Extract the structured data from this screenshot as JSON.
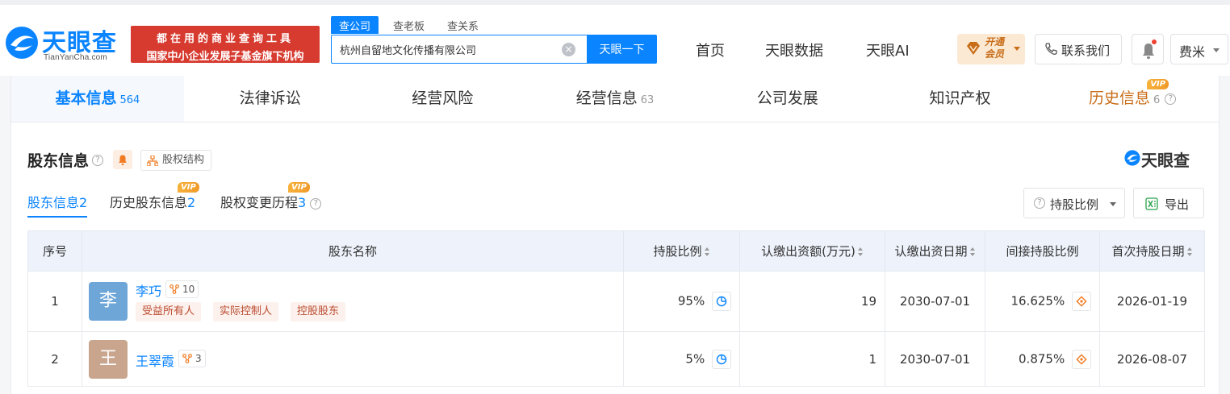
{
  "brand": {
    "name": "天眼查",
    "domain": "TianYanCha.com",
    "banner_line1": "都在用的商业查询工具",
    "banner_line2": "国家中小企业发展子基金旗下机构",
    "colors": {
      "accent": "#0a84ff",
      "banner": "#d73a2f",
      "vip": "#c86d18"
    }
  },
  "search": {
    "tabs": [
      "查公司",
      "查老板",
      "查关系"
    ],
    "active_tab": "查公司",
    "value": "杭州自留地文化传播有限公司",
    "button": "天眼一下",
    "clear_icon": "close-circle-icon"
  },
  "nav": {
    "items": [
      "首页",
      "天眼数据",
      "天眼AI"
    ],
    "vip_line1": "开通",
    "vip_line2": "会员",
    "contact": "联系我们",
    "user": "费米"
  },
  "main_tabs": [
    {
      "label": "基本信息",
      "count": "564"
    },
    {
      "label": "法律诉讼",
      "count": ""
    },
    {
      "label": "经营风险",
      "count": ""
    },
    {
      "label": "经营信息",
      "count": "63"
    },
    {
      "label": "公司发展",
      "count": ""
    },
    {
      "label": "知识产权",
      "count": ""
    },
    {
      "label": "历史信息",
      "count": "6",
      "vip": "VIP"
    }
  ],
  "section": {
    "title": "股东信息",
    "structure_btn": "股权结构",
    "watermark": "天眼查",
    "subtabs": [
      {
        "label": "股东信息",
        "count": "2"
      },
      {
        "label": "历史股东信息",
        "count": "2",
        "vip": "VIP"
      },
      {
        "label": "股权变更历程",
        "count": "3",
        "vip": "VIP"
      }
    ],
    "ratio_btn": "持股比例",
    "export_btn": "导出"
  },
  "table": {
    "headers": [
      "序号",
      "股东名称",
      "持股比例",
      "认缴出资额(万元)",
      "认缴出资日期",
      "间接持股比例",
      "首次持股日期"
    ],
    "rows": [
      {
        "index": "1",
        "avatar": "李",
        "avatar_color": "#6ea6d8",
        "name": "李巧",
        "relations": "10",
        "badges": [
          "受益所有人",
          "实际控制人",
          "控股股东"
        ],
        "ratio": "95%",
        "amount": "19",
        "date": "2030-07-01",
        "indirect": "16.625%",
        "first_date": "2026-01-19"
      },
      {
        "index": "2",
        "avatar": "王",
        "avatar_color": "#c8a58c",
        "name": "王翠霞",
        "relations": "3",
        "badges": [],
        "ratio": "5%",
        "amount": "1",
        "date": "2030-07-01",
        "indirect": "0.875%",
        "first_date": "2026-08-07"
      }
    ]
  }
}
